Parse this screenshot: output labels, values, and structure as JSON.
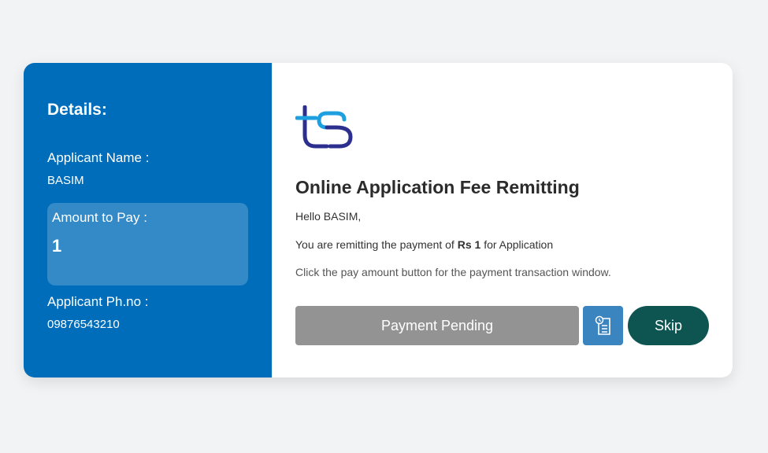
{
  "sidebar": {
    "title": "Details:",
    "applicant_name_label": "Applicant Name :",
    "applicant_name": "BASIM",
    "amount_label": "Amount to Pay :",
    "amount_value": "1",
    "phone_label": "Applicant Ph.no :",
    "phone_value": "09876543210"
  },
  "main": {
    "logo_text": "ts",
    "title": "Online Application Fee Remitting",
    "greeting": "Hello BASIM,",
    "remit_prefix": "You are remitting the payment of",
    "remit_amount": "Rs 1",
    "remit_suffix": "for Application",
    "hint": "Click the pay amount button for the payment transaction window."
  },
  "actions": {
    "pending_label": "Payment Pending",
    "receipt_icon": "receipt-icon",
    "skip_label": "Skip"
  },
  "colors": {
    "sidebar_bg": "#006dba",
    "pending_bg": "#939393",
    "receipt_bg": "#3a84c0",
    "skip_bg": "#0e5552",
    "logo_dark": "#2d2f8f",
    "logo_light": "#1ea0e0"
  }
}
